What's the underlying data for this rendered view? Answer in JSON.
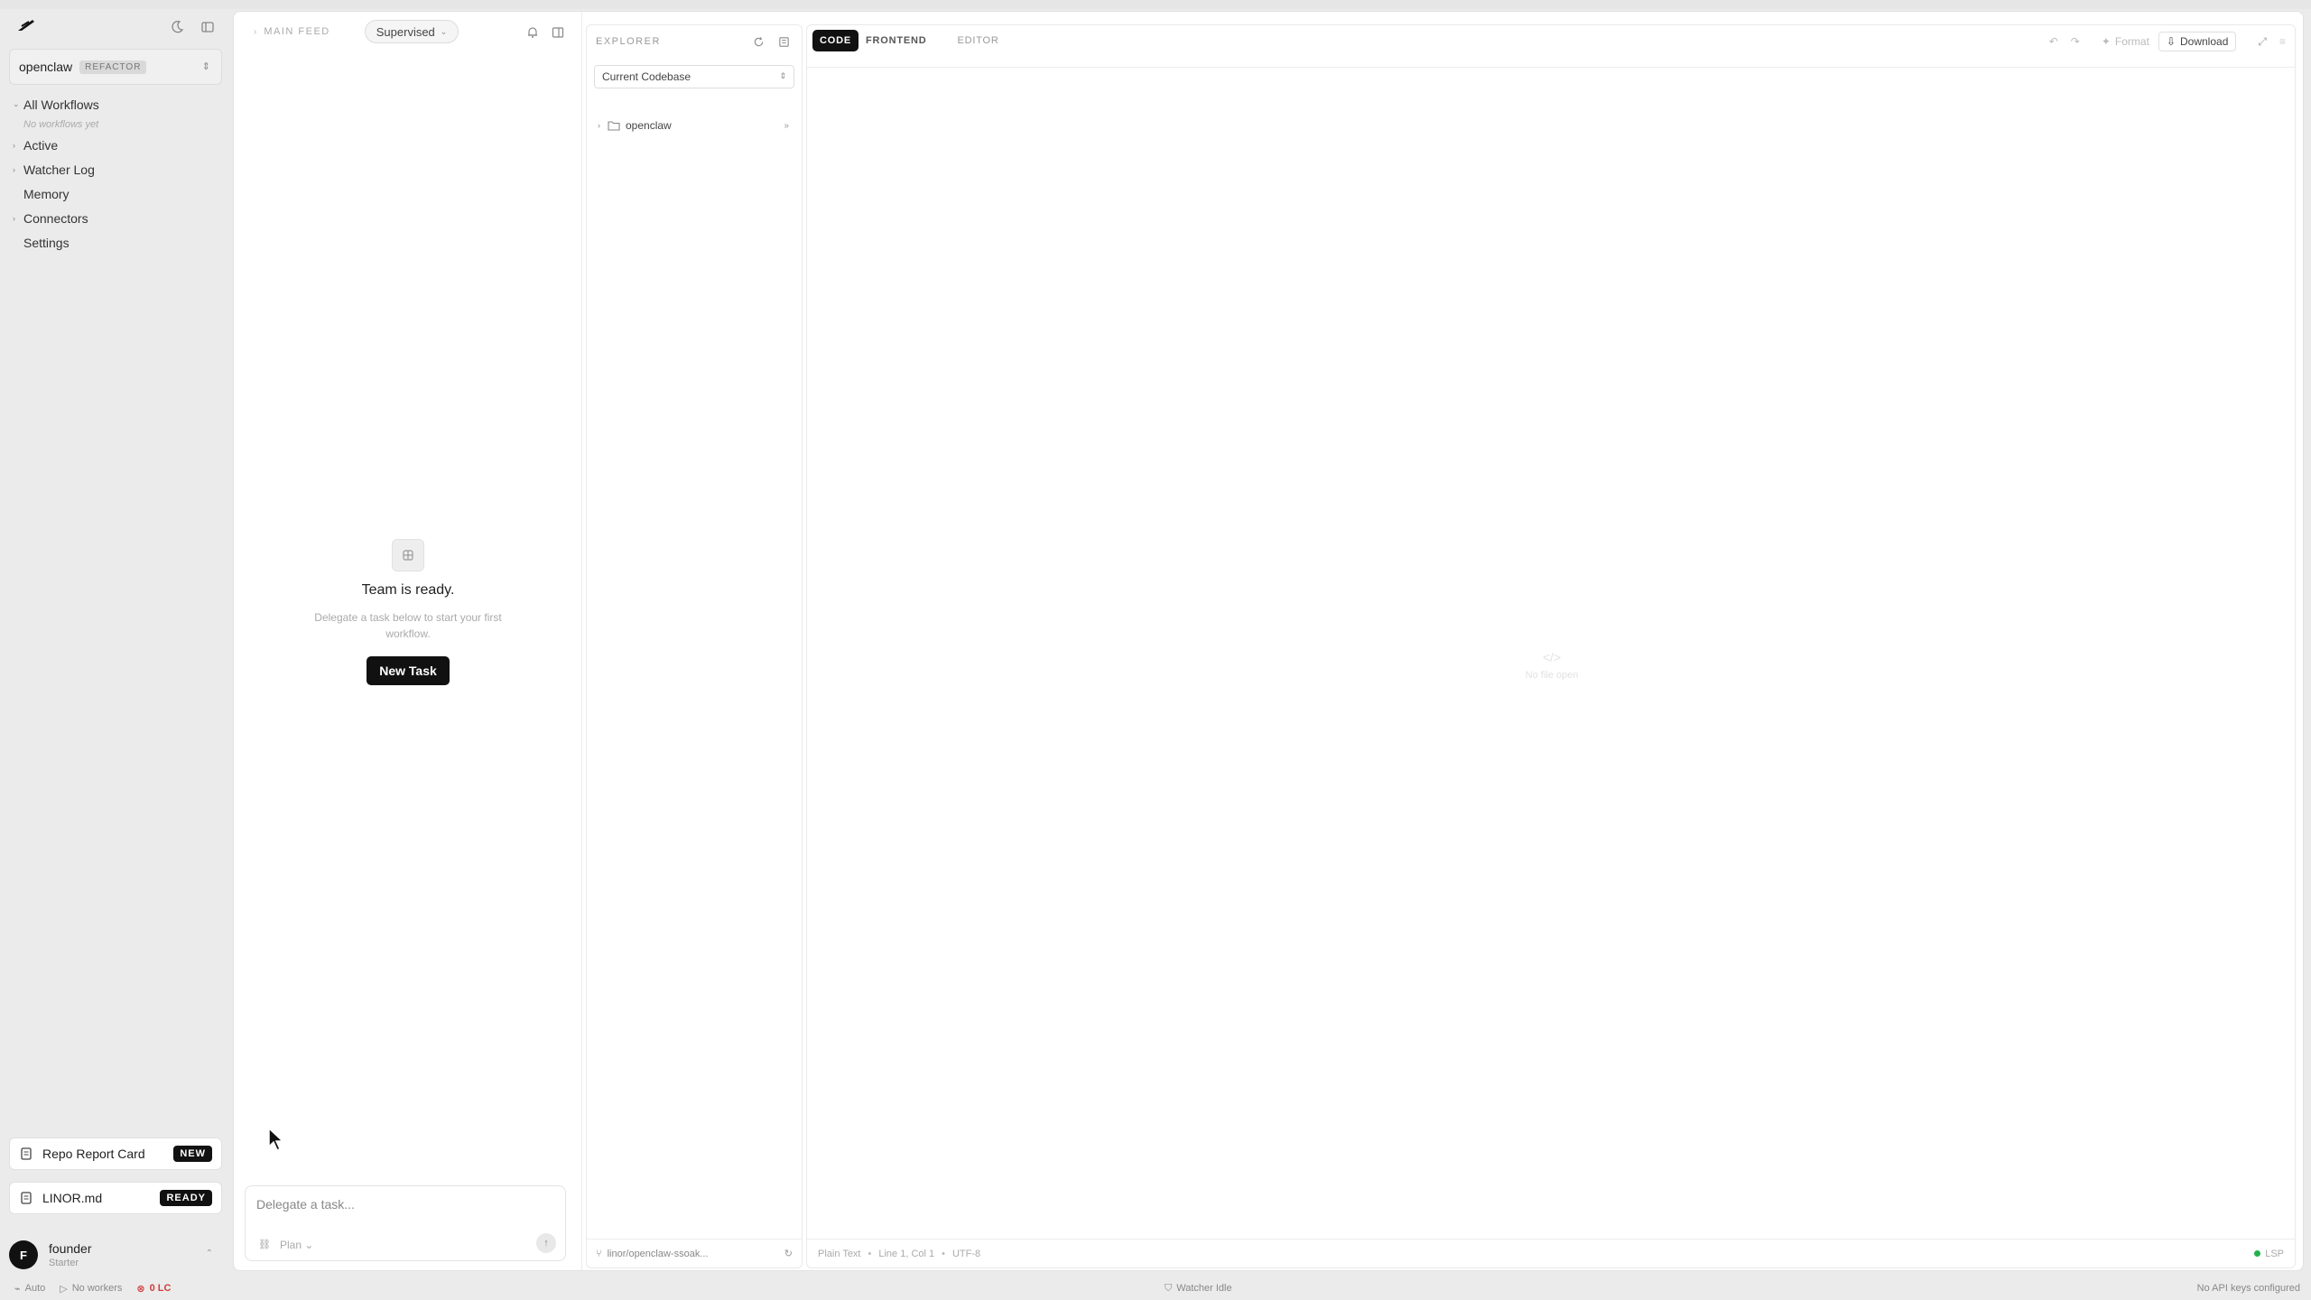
{
  "sidebar": {
    "project": {
      "name": "openclaw",
      "tag": "REFACTOR"
    },
    "nav": [
      {
        "label": "All Workflows",
        "expanded": true,
        "sub": "No workflows yet"
      },
      {
        "label": "Active",
        "expanded": false
      },
      {
        "label": "Watcher Log",
        "expanded": false
      },
      {
        "label": "Memory"
      },
      {
        "label": "Connectors",
        "expanded": false
      },
      {
        "label": "Settings"
      }
    ],
    "cards": [
      {
        "label": "Repo Report Card",
        "badge": "NEW"
      },
      {
        "label": "LINOR.md",
        "badge": "READY"
      }
    ],
    "user": {
      "initial": "F",
      "name": "founder",
      "plan": "Starter"
    }
  },
  "feed": {
    "title": "MAIN FEED",
    "mode": "Supervised",
    "empty_title": "Team is ready.",
    "empty_subtitle": "Delegate a task below to start your first workflow.",
    "new_task_label": "New Task",
    "compose_placeholder": "Delegate a task...",
    "plan_label": "Plan"
  },
  "explorer": {
    "title": "EXPLORER",
    "source": "Current Codebase",
    "root_folder": "openclaw",
    "branch": "linor/openclaw-ssoak..."
  },
  "editor": {
    "tabs": [
      "CODE",
      "FRONTEND",
      "EDITOR"
    ],
    "active_tab": "CODE",
    "tools": {
      "format_label": "Format",
      "download_label": "Download"
    },
    "empty_label": "No file open",
    "status": {
      "language": "Plain Text",
      "position": "Line 1, Col 1",
      "encoding": "UTF-8",
      "lsp": "LSP"
    }
  },
  "statusbar": {
    "mode": "Auto",
    "workers": "No workers",
    "lc": "0 LC",
    "watcher": "Watcher Idle",
    "api": "No API keys configured"
  },
  "colors": {
    "accent": "#111111",
    "lsp_ok": "#22b14c",
    "lc_alert": "#d23b3b"
  }
}
